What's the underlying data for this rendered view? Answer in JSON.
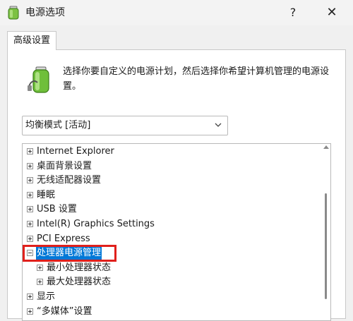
{
  "window": {
    "title": "电源选项",
    "help_label": "?",
    "close_label": "✕"
  },
  "tab": {
    "label": "高级设置"
  },
  "description": "选择你要自定义的电源计划，然后选择你希望计算机管理的电源设置。",
  "plan_select": {
    "value": "均衡模式 [活动]"
  },
  "tree": {
    "items": [
      {
        "label": "Internet Explorer",
        "level": 0,
        "expanded": false
      },
      {
        "label": "桌面背景设置",
        "level": 0,
        "expanded": false
      },
      {
        "label": "无线适配器设置",
        "level": 0,
        "expanded": false
      },
      {
        "label": "睡眠",
        "level": 0,
        "expanded": false
      },
      {
        "label": "USB 设置",
        "level": 0,
        "expanded": false
      },
      {
        "label": "Intel(R) Graphics Settings",
        "level": 0,
        "expanded": false
      },
      {
        "label": "PCI Express",
        "level": 0,
        "expanded": false
      },
      {
        "label": "处理器电源管理",
        "level": 0,
        "expanded": true,
        "selected": true
      },
      {
        "label": "最小处理器状态",
        "level": 1,
        "expanded": false
      },
      {
        "label": "最大处理器状态",
        "level": 1,
        "expanded": false
      },
      {
        "label": "显示",
        "level": 0,
        "expanded": false
      },
      {
        "label": "“多媒体”设置",
        "level": 0,
        "expanded": false
      }
    ]
  },
  "colors": {
    "selection": "#0078d7",
    "highlight_box": "#e0201c"
  },
  "icons": {
    "app": "power-options-icon",
    "battery": "battery-plug-icon",
    "dropdown": "chevron-down-icon"
  }
}
